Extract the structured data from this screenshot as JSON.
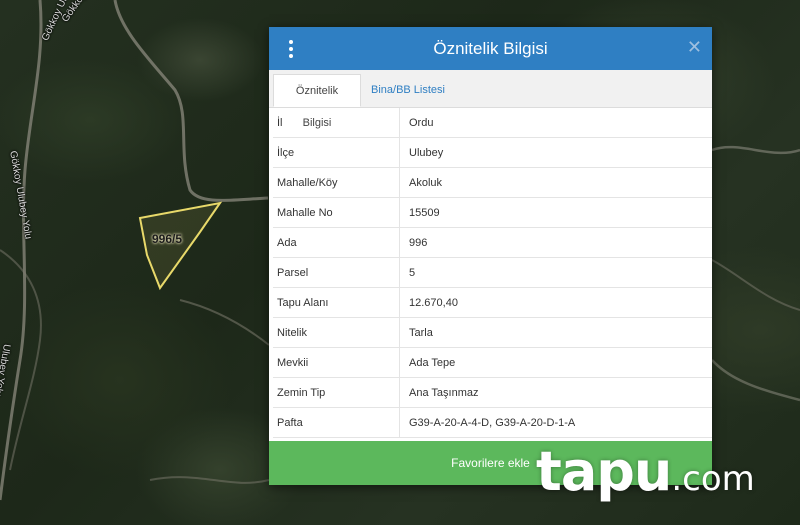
{
  "map": {
    "road_labels": [
      "Gökkoy Ulubey Yolu",
      "Gökkoy Ulubey Yolu",
      "Ulubey Yolu",
      "Gökkoy Ulubey Yolu"
    ],
    "parcel_label": "996/5",
    "parcel_outline_color": "#e8d96a"
  },
  "popup": {
    "title": "Öznitelik Bilgisi",
    "menu_icon": "kebab-menu-icon",
    "close_icon": "close-icon",
    "close_glyph": "✕",
    "header_color": "#2f7fc3",
    "tabs": [
      {
        "label": "Öznitelik Bilgisi",
        "active": true
      },
      {
        "label": "Bina/BB Listesi",
        "active": false
      }
    ],
    "rows": [
      {
        "key": "İl",
        "value": "Ordu"
      },
      {
        "key": "İlçe",
        "value": "Ulubey"
      },
      {
        "key": "Mahalle/Köy",
        "value": "Akoluk"
      },
      {
        "key": "Mahalle No",
        "value": "15509"
      },
      {
        "key": "Ada",
        "value": "996"
      },
      {
        "key": "Parsel",
        "value": "5"
      },
      {
        "key": "Tapu Alanı",
        "value": "12.670,40"
      },
      {
        "key": "Nitelik",
        "value": "Tarla"
      },
      {
        "key": "Mevkii",
        "value": "Ada Tepe"
      },
      {
        "key": "Zemin Tip",
        "value": "Ana Taşınmaz"
      },
      {
        "key": "Pafta",
        "value": "G39-A-20-A-4-D, G39-A-20-D-1-A"
      }
    ],
    "favorite_button": "Favorilere ekle",
    "favorite_color": "#5cb85c"
  },
  "watermark": {
    "main": "tapu",
    "tld": ".com"
  }
}
